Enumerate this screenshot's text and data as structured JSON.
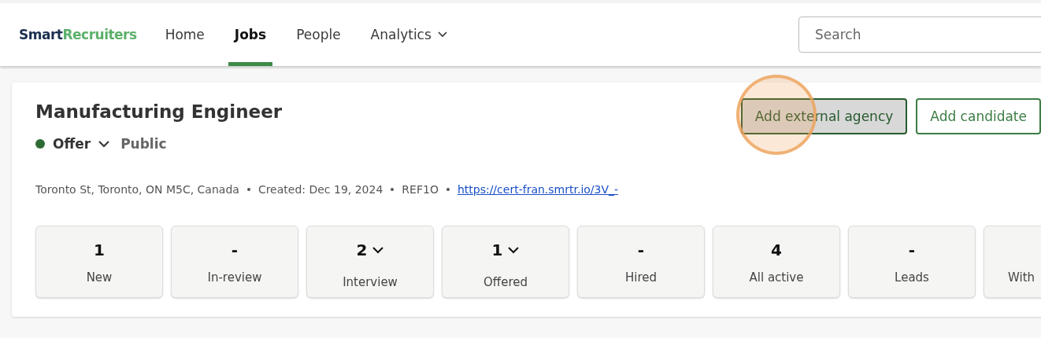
{
  "nav": {
    "logo": {
      "dark": "Smart",
      "light": "Recruiters"
    },
    "items": [
      {
        "label": "Home",
        "selected": false,
        "dropdown": false
      },
      {
        "label": "Jobs",
        "selected": true,
        "dropdown": false
      },
      {
        "label": "People",
        "selected": false,
        "dropdown": false
      },
      {
        "label": "Analytics",
        "selected": false,
        "dropdown": true
      }
    ],
    "search": {
      "placeholder": "Search"
    }
  },
  "job": {
    "title": "Manufacturing Engineer",
    "status": {
      "label": "Offer",
      "color": "#2e6b34"
    },
    "visibility": "Public",
    "meta": [
      "Toronto St, Toronto, ON M5C, Canada",
      "Created: Dec 19, 2024",
      "REF1O"
    ],
    "link": "https://cert-fran.smrtr.io/3V_-",
    "buttons": [
      {
        "label": "Add external agency",
        "kind": "highlighted"
      },
      {
        "label": "Add candidate",
        "kind": "outline"
      }
    ],
    "stats": [
      {
        "value": "1",
        "label": "New",
        "expandable": false
      },
      {
        "value": "-",
        "label": "In-review",
        "expandable": false
      },
      {
        "value": "2",
        "label": "Interview",
        "expandable": true
      },
      {
        "value": "1",
        "label": "Offered",
        "expandable": true
      },
      {
        "value": "-",
        "label": "Hired",
        "expandable": false
      },
      {
        "value": "4",
        "label": "All active",
        "expandable": false
      },
      {
        "value": "-",
        "label": "Leads",
        "expandable": false
      },
      {
        "label": "With",
        "expandable": false
      }
    ]
  }
}
